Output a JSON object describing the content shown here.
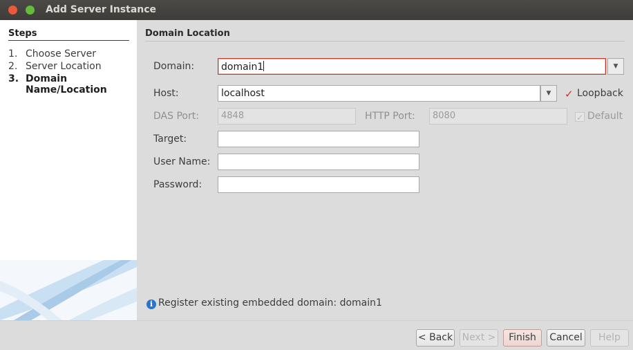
{
  "window": {
    "title": "Add Server Instance",
    "controls": [
      "close",
      "maximize"
    ]
  },
  "steps": {
    "heading": "Steps",
    "items": [
      {
        "number": "1.",
        "label": "Choose Server",
        "active": false
      },
      {
        "number": "2.",
        "label": "Server Location",
        "active": false
      },
      {
        "number": "3.",
        "label": "Domain",
        "label2": "Name/Location",
        "active": true
      }
    ]
  },
  "section": {
    "title": "Domain Location"
  },
  "form": {
    "domain_label": "Domain:",
    "domain_value": "domain1",
    "host_label": "Host:",
    "host_value": "localhost",
    "loopback_label": "Loopback",
    "loopback_checked": true,
    "das_port_label": "DAS Port:",
    "das_port_value": "4848",
    "http_port_label": "HTTP Port:",
    "http_port_value": "8080",
    "default_label": "Default",
    "default_checked": true,
    "target_label": "Target:",
    "target_value": "",
    "username_label": "User Name:",
    "username_value": "",
    "password_label": "Password:",
    "password_value": ""
  },
  "info_message": "Register existing embedded domain: domain1",
  "buttons": {
    "back": "< Back",
    "next": "Next >",
    "finish": "Finish",
    "cancel": "Cancel",
    "help": "Help"
  },
  "colors": {
    "accent_red": "#c0392b",
    "info_blue": "#2b74c7",
    "titlebar": "#3d3c38"
  }
}
